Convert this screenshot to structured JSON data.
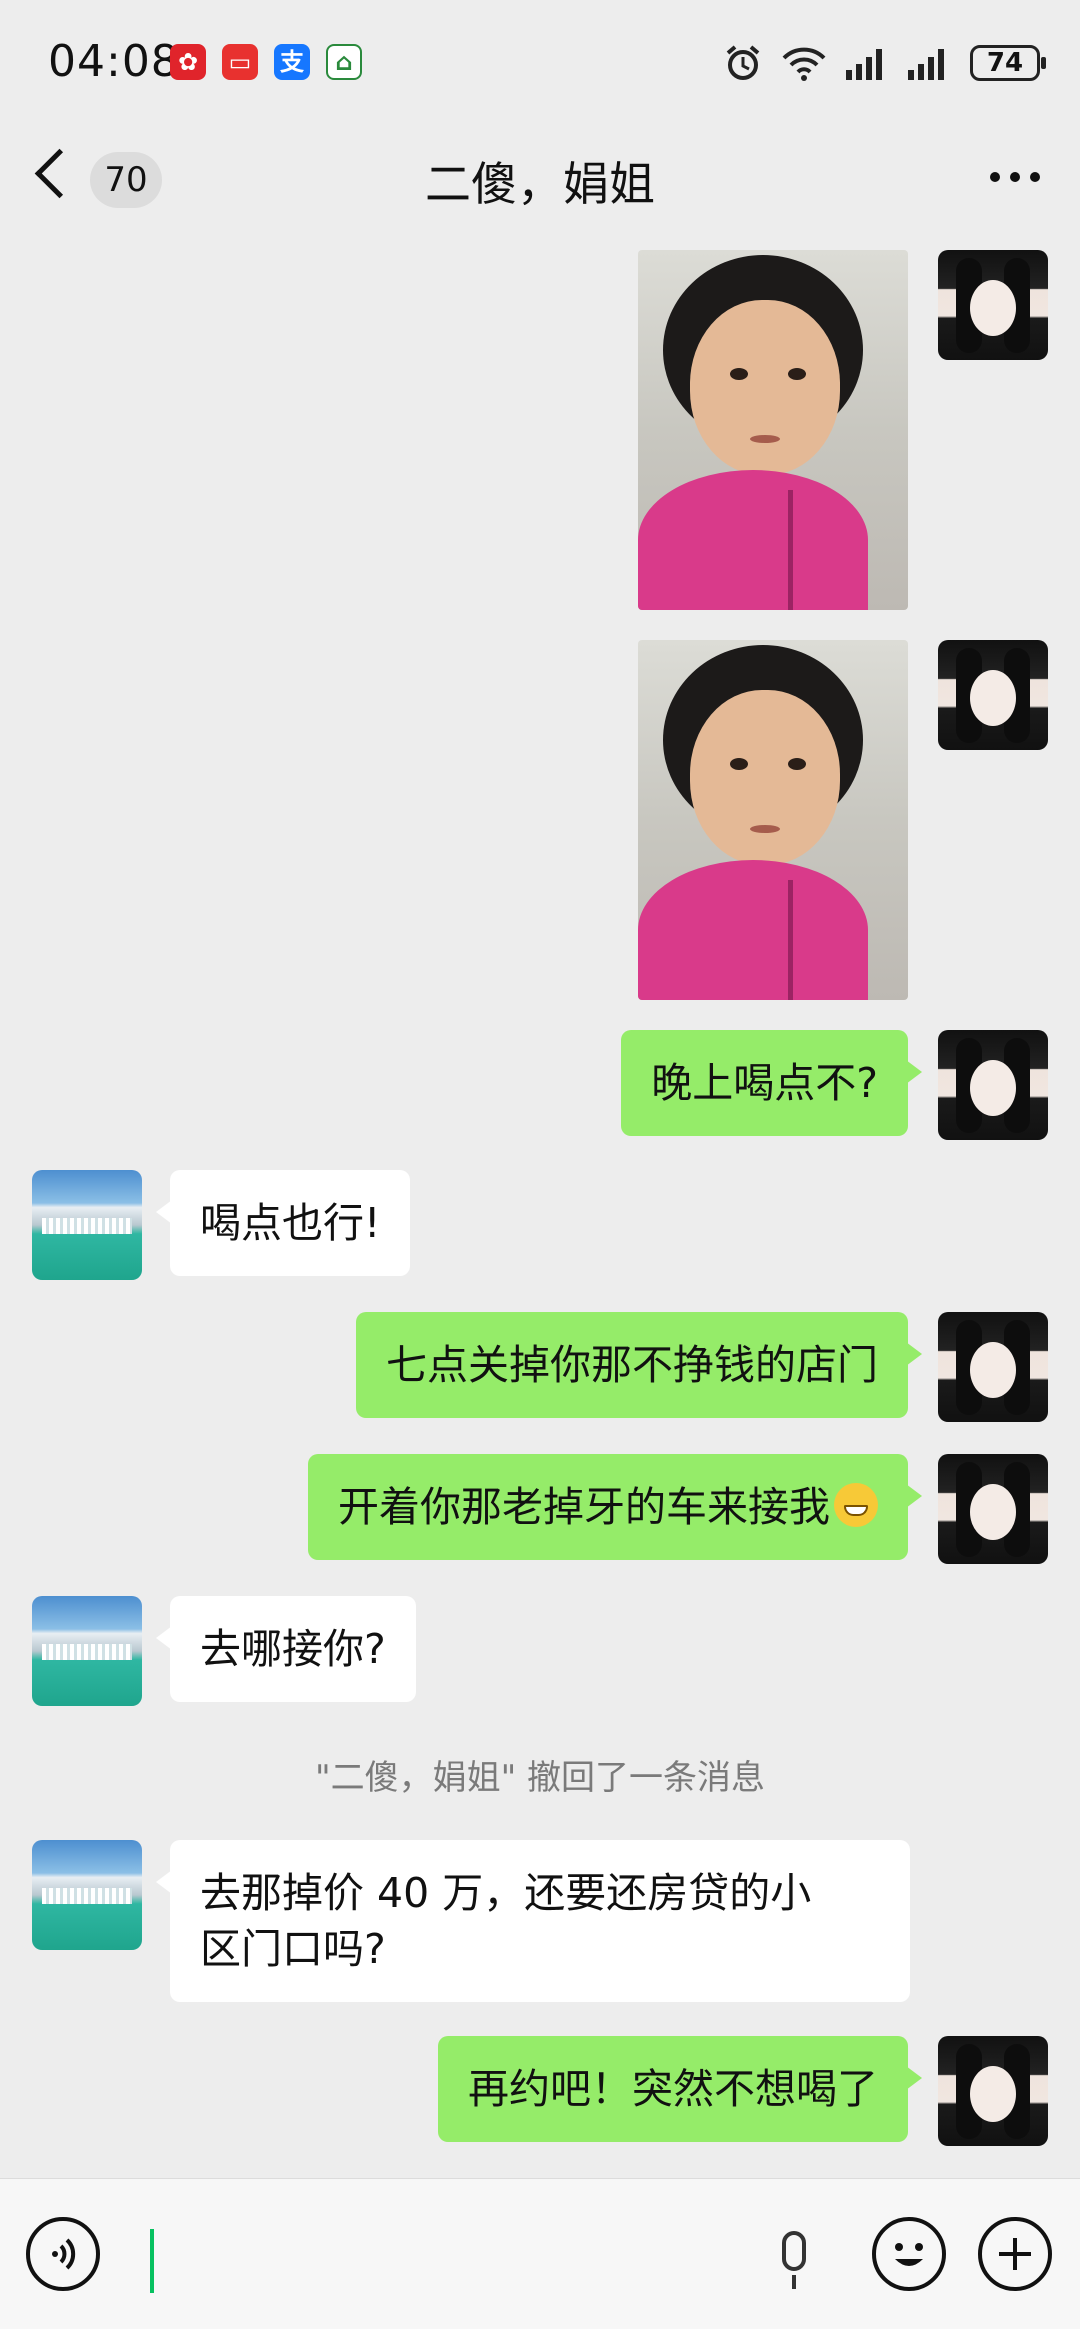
{
  "status_bar": {
    "time": "04:08",
    "battery": "74",
    "app_icons": [
      "pinduoduo-icon",
      "red-app-icon",
      "alipay-icon",
      "home-icon"
    ],
    "alipay_glyph": "支"
  },
  "header": {
    "unread_count": "70",
    "title": "二傻，娟姐"
  },
  "messages": [
    {
      "sender": "me",
      "type": "image",
      "content": "photo-child-pink-coat"
    },
    {
      "sender": "me",
      "type": "image",
      "content": "photo-child-pink-coat"
    },
    {
      "sender": "me",
      "type": "text",
      "text": "晚上喝点不?"
    },
    {
      "sender": "them",
      "type": "text",
      "text": "喝点也行!"
    },
    {
      "sender": "me",
      "type": "text",
      "text": "七点关掉你那不挣钱的店门"
    },
    {
      "sender": "me",
      "type": "text",
      "text": "开着你那老掉牙的车来接我",
      "emoji": "grin-emoji"
    },
    {
      "sender": "them",
      "type": "text",
      "text": "去哪接你?"
    },
    {
      "sender": "system",
      "type": "recall",
      "text": "\"二傻，娟姐\" 撤回了一条消息"
    },
    {
      "sender": "them",
      "type": "text",
      "line1": "去那掉价 40 万，还要还房贷的小",
      "line2": "区门口吗?"
    },
    {
      "sender": "me",
      "type": "text",
      "text": "再约吧！突然不想喝了"
    }
  ],
  "input_bar": {
    "value": ""
  },
  "colors": {
    "my_bubble": "#95ec69",
    "their_bubble": "#ffffff",
    "background": "#ededed",
    "caret": "#07c160"
  }
}
